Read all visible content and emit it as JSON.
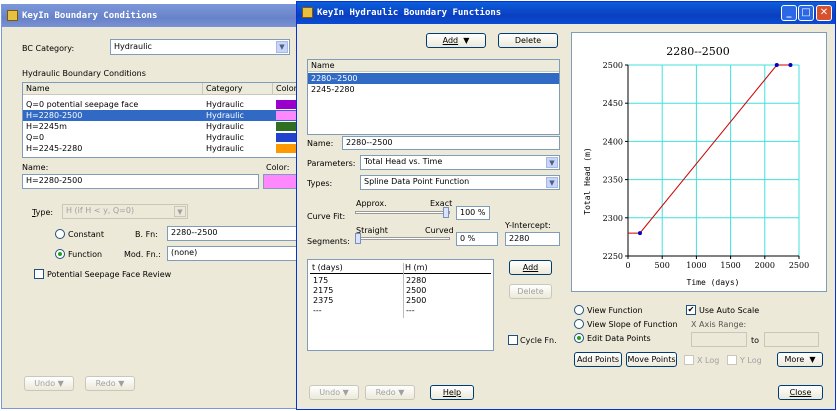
{
  "bc_window": {
    "title": "KeyIn Boundary Conditions",
    "bc_category_label": "BC Category:",
    "bc_category_value": "Hydraulic",
    "section_title": "Hydraulic Boundary Conditions",
    "columns": [
      "Name",
      "Category",
      "Color"
    ],
    "rows": [
      {
        "name": "Q=0 potential seepage face",
        "category": "Hydraulic",
        "color": "#9900cc"
      },
      {
        "name": "H=2280-2500",
        "category": "Hydraulic",
        "color": "#ff88ff"
      },
      {
        "name": "H=2245m",
        "category": "Hydraulic",
        "color": "#2f6f1f"
      },
      {
        "name": "Q=0",
        "category": "Hydraulic",
        "color": "#2244cc"
      },
      {
        "name": "H=2245-2280",
        "category": "Hydraulic",
        "color": "#ff9900"
      }
    ],
    "name_label": "Name:",
    "name_value": "H=2280-2500",
    "color_label": "Color:",
    "color_value": "#ff88ff",
    "type_label": "Type:",
    "type_value": "H (if H < y, Q=0)",
    "constant_label": "Constant",
    "function_label": "Function",
    "bfn_label": "B. Fn:",
    "bfn_value": "2280--2500",
    "modfn_label": "Mod. Fn.:",
    "modfn_value": "(none)",
    "seepage_label": "Potential Seepage Face Review",
    "undo_label": "Undo",
    "redo_label": "Redo"
  },
  "hyd_window": {
    "title": "KeyIn Hydraulic Boundary Functions",
    "add_label": "Add",
    "delete_label": "Delete",
    "list_header": "Name",
    "functions": [
      "2280--2500",
      "2245-2280"
    ],
    "name_label": "Name:",
    "name_value": "2280--2500",
    "parameters_label": "Parameters:",
    "parameters_value": "Total Head vs. Time",
    "types_label": "Types:",
    "types_value": "Spline Data Point Function",
    "approx_label": "Approx.",
    "exact_label": "Exact",
    "curvefit_label": "Curve Fit:",
    "curvefit_value": "100 %",
    "straight_label": "Straight",
    "curved_label": "Curved",
    "segments_label": "Segments:",
    "segments_value": "0 %",
    "yintercept_label": "Y-Intercept:",
    "yintercept_value": "2280",
    "table_headers": [
      "t (days)",
      "H (m)"
    ],
    "table_rows": [
      [
        "175",
        "2280"
      ],
      [
        "2175",
        "2500"
      ],
      [
        "2375",
        "2500"
      ],
      [
        "---",
        "---"
      ]
    ],
    "add_point_label": "Add",
    "delete_point_label": "Delete",
    "cycle_label": "Cycle Fn.",
    "view_function_label": "View Function",
    "view_slope_label": "View Slope of Function",
    "edit_points_label": "Edit Data Points",
    "auto_scale_label": "Use Auto Scale",
    "xrange_label": "X Axis Range:",
    "to_label": "to",
    "add_points_label": "Add Points",
    "move_points_label": "Move Points",
    "xlog_label": "X Log",
    "ylog_label": "Y Log",
    "more_label": "More",
    "undo_label": "Undo",
    "redo_label": "Redo",
    "help_label": "Help",
    "close_label": "Close"
  },
  "chart_data": {
    "type": "line",
    "title": "2280--2500",
    "xlabel": "Time (days)",
    "ylabel": "Total Head (m)",
    "xlim": [
      0,
      2500
    ],
    "ylim": [
      2250,
      2500
    ],
    "xticks": [
      0,
      500,
      1000,
      1500,
      2000,
      2500
    ],
    "yticks": [
      2250,
      2300,
      2350,
      2400,
      2450,
      2500
    ],
    "grid": true,
    "line_color": "#cc0000",
    "point_color": "#0000cc",
    "points": [
      {
        "x": 175,
        "y": 2280
      },
      {
        "x": 2175,
        "y": 2500
      },
      {
        "x": 2375,
        "y": 2500
      }
    ],
    "intercept": {
      "x": 0,
      "y": 2280
    }
  }
}
